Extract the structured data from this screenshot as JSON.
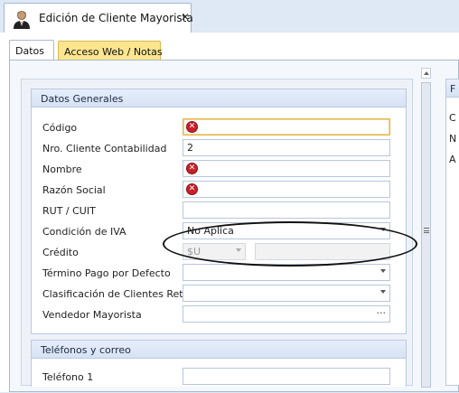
{
  "document_tab": {
    "title": "Edición de Cliente Mayorista",
    "close_label": "✕"
  },
  "subtabs": [
    {
      "label": "Datos",
      "active": true
    },
    {
      "label": "Acceso Web / Notas",
      "active": false
    }
  ],
  "datos_generales": {
    "header": "Datos Generales",
    "fields": {
      "codigo": {
        "label": "Código",
        "value": "",
        "error": true
      },
      "nro_cliente": {
        "label": "Nro. Cliente Contabilidad",
        "value": "2"
      },
      "nombre": {
        "label": "Nombre",
        "value": "",
        "error": true
      },
      "razon_social": {
        "label": "Razón Social",
        "value": "",
        "error": true
      },
      "rut_cuit": {
        "label": "RUT / CUIT",
        "value": ""
      },
      "condicion_iva": {
        "label": "Condición de IVA",
        "value": "No Aplica"
      },
      "credito": {
        "label": "Crédito",
        "currency": "$U",
        "amount": ""
      },
      "termino_pago": {
        "label": "Término Pago por Defecto",
        "value": ""
      },
      "clasificacion": {
        "label": "Clasificación de Clientes Retail",
        "value": ""
      },
      "vendedor": {
        "label": "Vendedor Mayorista",
        "value": "",
        "button": "···"
      }
    }
  },
  "telefonos": {
    "header": "Teléfonos y correo",
    "fields": {
      "telefono1": {
        "label": "Teléfono 1",
        "value": ""
      }
    }
  },
  "right_panel": {
    "header": "F",
    "labels": [
      "C",
      "N",
      "A"
    ]
  },
  "colors": {
    "error": "#c8202a",
    "active_tab": "#fbe58f",
    "focus": "#e6b64a"
  }
}
